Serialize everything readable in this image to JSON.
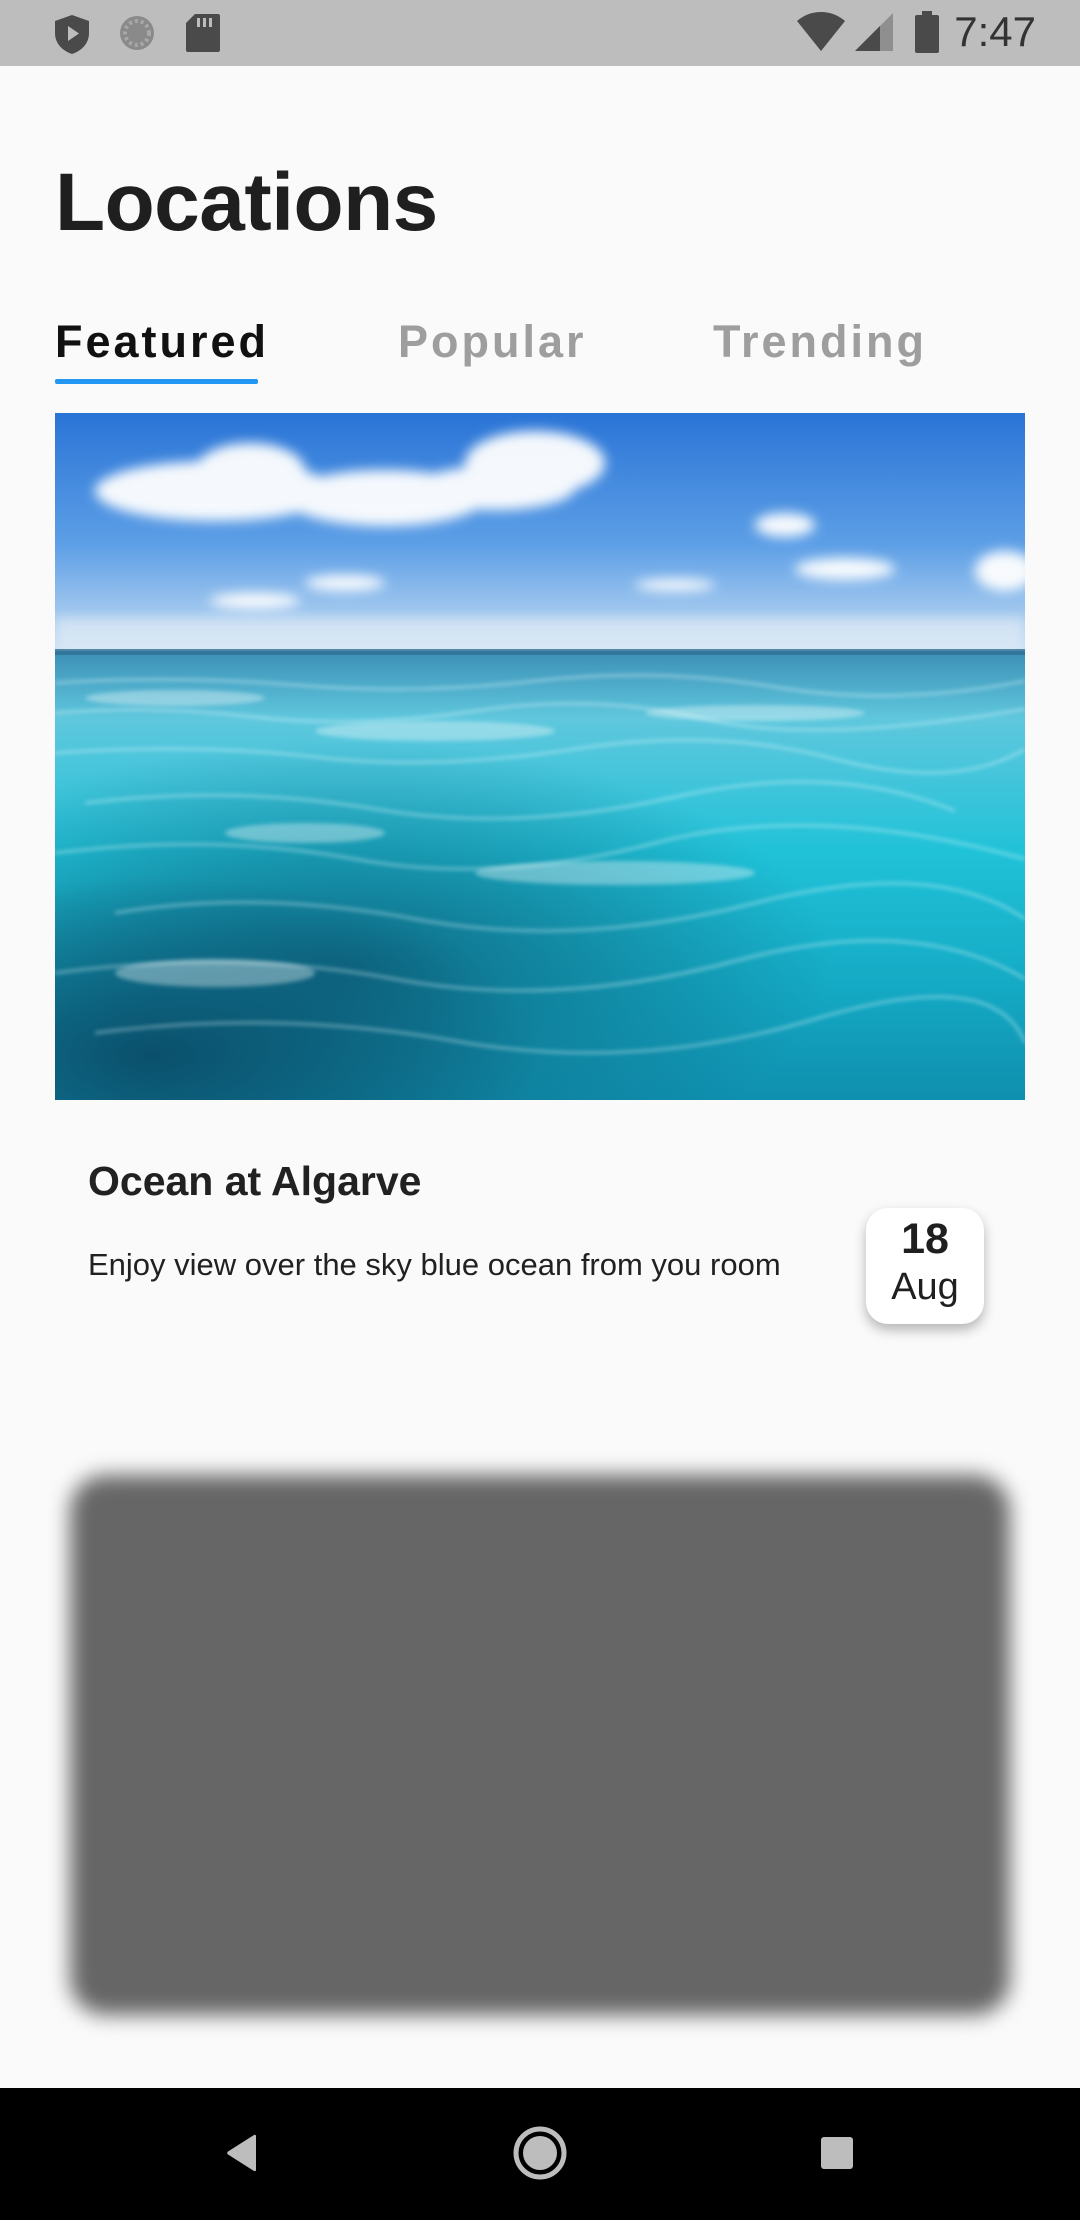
{
  "status_bar": {
    "time": "7:47",
    "left_icons": [
      "shield-icon",
      "sync-icon",
      "sd-card-icon"
    ],
    "right_icons": [
      "wifi-icon",
      "signal-icon",
      "battery-icon"
    ]
  },
  "page": {
    "title": "Locations"
  },
  "tabs": [
    {
      "label": "Featured",
      "active": true
    },
    {
      "label": "Popular",
      "active": false
    },
    {
      "label": "Trending",
      "active": false
    }
  ],
  "accent_color": "#2196f3",
  "featured_card": {
    "image": "ocean-photo",
    "title": "Ocean at Algarve",
    "description": "Enjoy view over the sky blue ocean from you room",
    "date_day": "18",
    "date_month": "Aug"
  },
  "nav_bar": {
    "buttons": [
      "back-icon",
      "home-icon",
      "recents-icon"
    ]
  }
}
